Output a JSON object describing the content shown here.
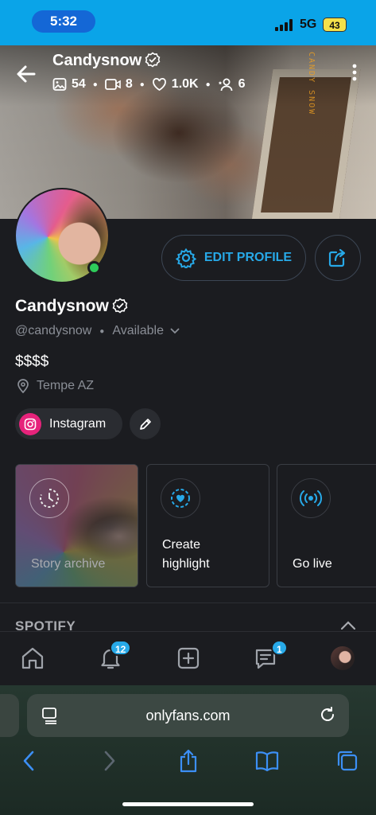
{
  "status_bar": {
    "time": "5:32",
    "network": "5G",
    "battery": "43"
  },
  "profile": {
    "name": "Candysnow",
    "handle": "@candysnow",
    "availability": "Available",
    "price": "$$$$",
    "location": "Tempe AZ",
    "cover_watermark": "CANDY SNOW"
  },
  "stats": {
    "photos": "54",
    "videos": "8",
    "likes": "1.0K",
    "fans": "6"
  },
  "actions": {
    "edit_profile": "EDIT PROFILE"
  },
  "social": {
    "instagram_label": "Instagram"
  },
  "highlights": {
    "story_archive": "Story archive",
    "create_line1": "Create",
    "create_line2": "highlight",
    "go_live": "Go live"
  },
  "sections": {
    "spotify": "SPOTIFY"
  },
  "nav": {
    "notifications_badge": "12",
    "messages_badge": "1"
  },
  "browser": {
    "url": "onlyfans.com"
  },
  "colors": {
    "accent": "#27a9e8",
    "online": "#2ecc5a",
    "instagram": "#e6237b",
    "background": "#1b1c20"
  }
}
